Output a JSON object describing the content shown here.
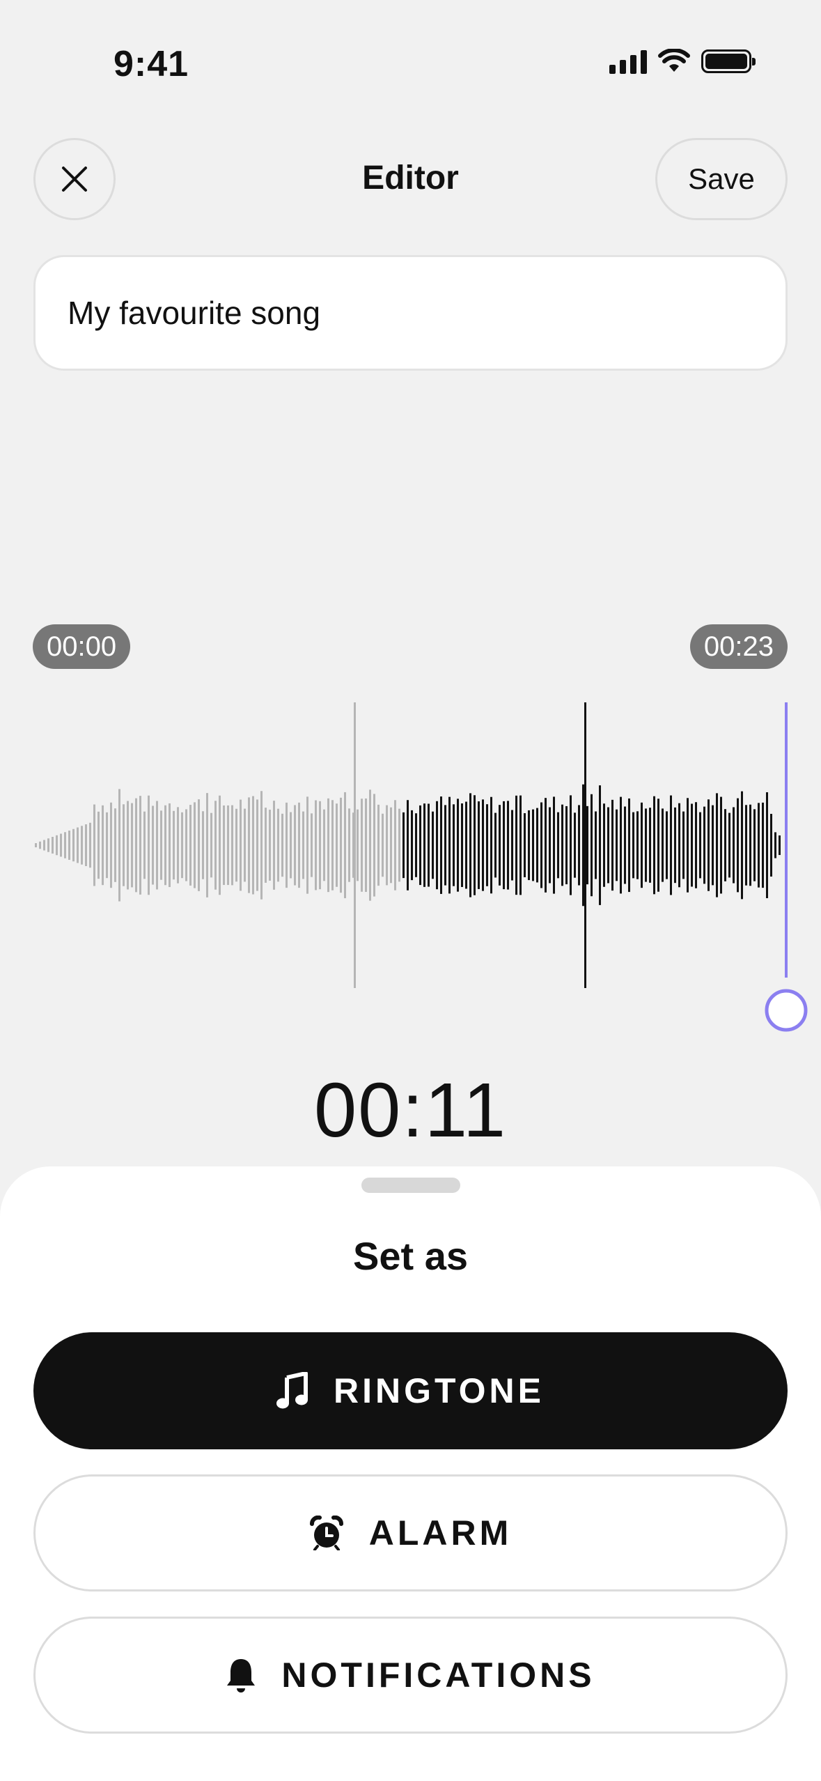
{
  "status_bar": {
    "time": "9:41"
  },
  "header": {
    "title": "Editor",
    "save_label": "Save"
  },
  "name_field": {
    "value": "My favourite song"
  },
  "timeline": {
    "start": "00:00",
    "end": "00:23",
    "current": "00:11"
  },
  "colors": {
    "accent": "#8b7ff0",
    "played": "#111111",
    "unplayed": "#b5b5b5"
  },
  "sheet": {
    "title": "Set as",
    "options": [
      {
        "label": "RINGTONE",
        "icon": "music-note-icon"
      },
      {
        "label": "ALARM",
        "icon": "alarm-clock-icon"
      },
      {
        "label": "NOTIFICATIONS",
        "icon": "bell-icon"
      }
    ]
  }
}
